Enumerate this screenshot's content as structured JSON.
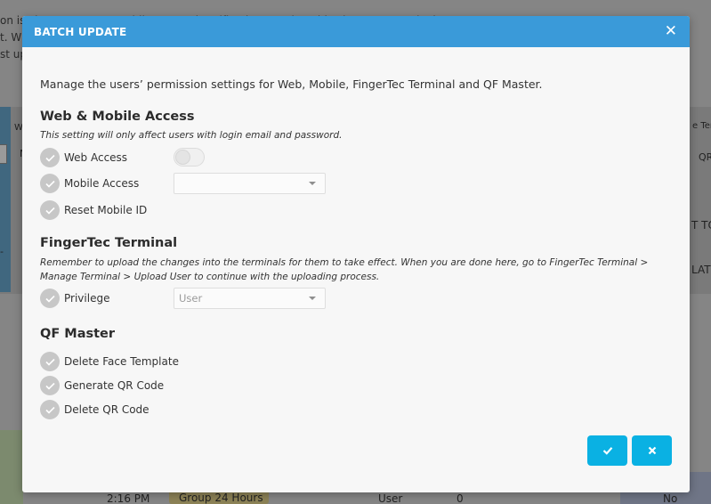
{
  "background": {
    "top_lines": [
      "on is  TimeTec Access mobile app and notifications, and enable FingerTec Terminal ...",
      "t. Wh",
      "st up"
    ],
    "fragments": {
      "left_w": "W",
      "left_n": "N",
      "right_tem": "e Tem",
      "right_qr": "QR",
      "right_to": "T TO",
      "right_late": "LATE",
      "left_dash": "-",
      "bottom_time": "2:16 PM",
      "bottom_group": "Group 24 Hours",
      "bottom_user": "User",
      "bottom_zero": "0",
      "bottom_no": "No"
    }
  },
  "modal": {
    "title": "BATCH UPDATE",
    "close_glyph": "✕",
    "intro": "Manage the users’ permission settings for Web, Mobile, FingerTec Terminal and QF Master.",
    "web_mobile": {
      "title": "Web & Mobile Access",
      "note": "This setting will only affect users with login email and password.",
      "options": {
        "web_access": "Web Access",
        "mobile_access": "Mobile Access",
        "reset_mobile_id": "Reset Mobile ID"
      },
      "web_access_toggle": "off",
      "mobile_access_select_value": ""
    },
    "fingertec": {
      "title": "FingerTec Terminal",
      "note": "Remember to upload the changes into the terminals for them to take effect. When you are done here, go to FingerTec Terminal > Manage Terminal > Upload User to continue with the uploading process.",
      "options": {
        "privilege": "Privilege"
      },
      "privilege_select_value": "User"
    },
    "qf_master": {
      "title": "QF Master",
      "options": {
        "delete_face_template": "Delete Face Template",
        "generate_qr_code": "Generate QR Code",
        "delete_qr_code": "Delete QR Code"
      }
    },
    "buttons": {
      "confirm_icon": "check-icon",
      "cancel_icon": "x-icon"
    },
    "colors": {
      "header": "#3a9ad9",
      "button": "#0ab1e3",
      "check_circle": "#c7c7c7"
    }
  }
}
